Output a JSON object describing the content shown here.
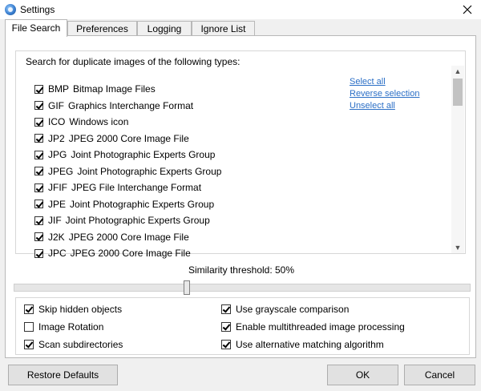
{
  "window": {
    "title": "Settings"
  },
  "tabs": [
    "File Search",
    "Preferences",
    "Logging",
    "Ignore List"
  ],
  "types_section": {
    "title": "Search for duplicate images of the following types:"
  },
  "file_types": [
    {
      "ext": "BMP",
      "desc": "Bitmap Image Files",
      "checked": true
    },
    {
      "ext": "GIF",
      "desc": "Graphics Interchange Format",
      "checked": true
    },
    {
      "ext": "ICO",
      "desc": "Windows icon",
      "checked": true
    },
    {
      "ext": "JP2",
      "desc": "JPEG 2000 Core Image File",
      "checked": true
    },
    {
      "ext": "JPG",
      "desc": "Joint Photographic Experts Group",
      "checked": true
    },
    {
      "ext": "JPEG",
      "desc": "Joint Photographic Experts Group",
      "checked": true
    },
    {
      "ext": "JFIF",
      "desc": "JPEG File Interchange Format",
      "checked": true
    },
    {
      "ext": "JPE",
      "desc": "Joint Photographic Experts Group",
      "checked": true
    },
    {
      "ext": "JIF",
      "desc": "Joint Photographic Experts Group",
      "checked": true
    },
    {
      "ext": "J2K",
      "desc": "JPEG 2000 Core Image File",
      "checked": true
    },
    {
      "ext": "JPC",
      "desc": "JPEG 2000 Core Image File",
      "checked": true
    }
  ],
  "links": {
    "select_all": "Select all",
    "reverse": "Reverse selection",
    "unselect_all": "Unselect all"
  },
  "similarity": {
    "label": "Similarity threshold: 50%",
    "value": 50
  },
  "options": {
    "skip_hidden": {
      "label": "Skip hidden objects",
      "checked": true
    },
    "image_rotation": {
      "label": "Image Rotation",
      "checked": false
    },
    "scan_subdirs": {
      "label": "Scan subdirectories",
      "checked": true
    },
    "grayscale": {
      "label": "Use grayscale comparison",
      "checked": true
    },
    "multithreaded": {
      "label": "Enable multithreaded image processing",
      "checked": true
    },
    "alt_algorithm": {
      "label": "Use alternative matching algorithm",
      "checked": true
    }
  },
  "buttons": {
    "restore": "Restore Defaults",
    "ok": "OK",
    "cancel": "Cancel"
  }
}
